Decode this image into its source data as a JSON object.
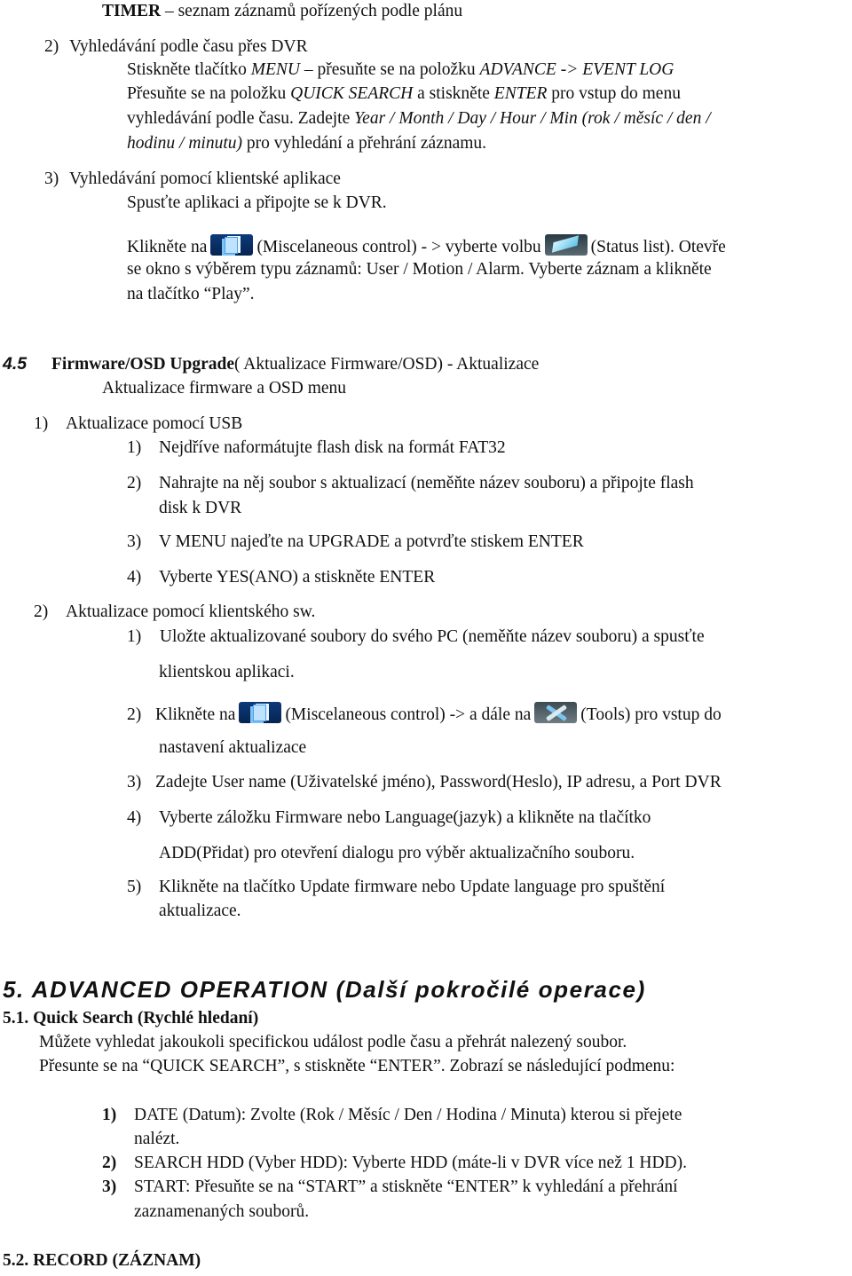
{
  "timer_line": {
    "term": "TIMER",
    "rest": " – seznam záznamů pořízených podle plánu"
  },
  "sec2": {
    "num": "2)",
    "title": "Vyhledávání podle času přes DVR",
    "l1": {
      "a": "Stiskněte tlačítko ",
      "b": "MENU",
      "c": " – přesuňte se na položku ",
      "d": "ADVANCE -> EVENT LOG"
    },
    "l2": {
      "a": "Přesuňte se na položku ",
      "b": "QUICK SEARCH",
      "c": " a stiskněte ",
      "d": "ENTER",
      "e": " pro vstup do menu"
    },
    "l3": {
      "a": "vyhledávání podle času. Zadejte ",
      "b": "Year / Month / Day / Hour / Min (rok / měsíc / den /"
    },
    "l4": {
      "a": "hodinu / minutu)",
      "b": " pro vyhledání a přehrání záznamu."
    }
  },
  "sec3": {
    "num": "3)",
    "title": "Vyhledávání pomocí klientské aplikace",
    "l1": "Spusťte aplikaci a připojte se k DVR.",
    "l2": {
      "a": "Klikněte na",
      "b": "(Miscelaneous control) - > vyberte volbu",
      "c": "(Status list). Otevře"
    },
    "l3": "se okno s výběrem typu záznamů:  User / Motion / Alarm. Vyberte záznam a klikněte",
    "l4": "na tlačítko “Play”."
  },
  "icons": {
    "misc": "miscellaneous-control-icon",
    "status": "status-list-icon",
    "tools": "tools-icon"
  },
  "fw": {
    "num": "4.5",
    "title": "Firmware/OSD Upgrade",
    "title_rest": "( Aktualizace Firmware/OSD) - Aktualizace",
    "subtitle": "Aktualizace firmware a OSD menu",
    "usb": {
      "num": "1)",
      "title": "Aktualizace pomocí USB",
      "steps": [
        {
          "num": "1)",
          "text": "Nejdříve naformátujte flash disk na formát FAT32"
        },
        {
          "num": "2)",
          "text": "Nahrajte na něj soubor s aktualizací (neměňte název souboru) a připojte flash",
          "cont": "disk k DVR"
        },
        {
          "num": "3)",
          "text": "V MENU najeďte na  UPGRADE a potvrďte stiskem ENTER"
        },
        {
          "num": "4)",
          "text": "Vyberte YES(ANO) a stiskněte ENTER"
        }
      ]
    },
    "client": {
      "num": "2)",
      "title": "Aktualizace pomocí klientského sw.",
      "s1": {
        "num": "1)",
        "text": " Uložte aktualizované soubory do svého PC (neměňte název souboru) a spusťte",
        "cont": "klientskou aplikaci."
      },
      "s2": {
        "num": "2)",
        "a": "Klikněte na",
        "b": "(Miscelaneous control) -> a dále na",
        "c": "(Tools)  pro vstup do",
        "cont": "nastavení aktualizace"
      },
      "s3": {
        "num": "3)",
        "text": "Zadejte User name (Uživatelské jméno), Password(Heslo), IP adresu, a Port DVR"
      },
      "s4": {
        "num": "4)",
        "text": "Vyberte záložku Firmware nebo Language(jazyk) a klikněte na tlačítko",
        "cont": "ADD(Přidat) pro otevření dialogu pro výběr aktualizačního souboru."
      },
      "s5": {
        "num": "5)",
        "text": "Klikněte na tlačítko Update firmware nebo Update language pro spuštění",
        "cont": "aktualizace."
      }
    }
  },
  "adv": {
    "heading": "5. ADVANCED OPERATION (Další pokročilé operace)",
    "qs": {
      "title": "5.1. Quick Search (Rychlé hledaní)",
      "p1": "Můžete vyhledat jakoukoli specifickou událost podle času a přehrát nalezený soubor.",
      "p2": "Přesunte se na “QUICK SEARCH”, s stiskněte “ENTER”. Zobrazí se následující podmenu:",
      "items": [
        {
          "num": "1)",
          "text": "DATE (Datum): Zvolte (Rok / Měsíc / Den / Hodina /  Minuta) kterou si přejete",
          "cont": "nalézt."
        },
        {
          "num": "2)",
          "text": "SEARCH HDD (Vyber HDD): Vyberte HDD (máte-li v DVR více než 1 HDD)."
        },
        {
          "num": "3)",
          "text": "START: Přesuňte se na “START” a stiskněte “ENTER”  k vyhledání a přehrání",
          "cont": " zaznamenaných souborů."
        }
      ]
    },
    "record": "5.2.  RECORD (ZÁZNAM)"
  }
}
